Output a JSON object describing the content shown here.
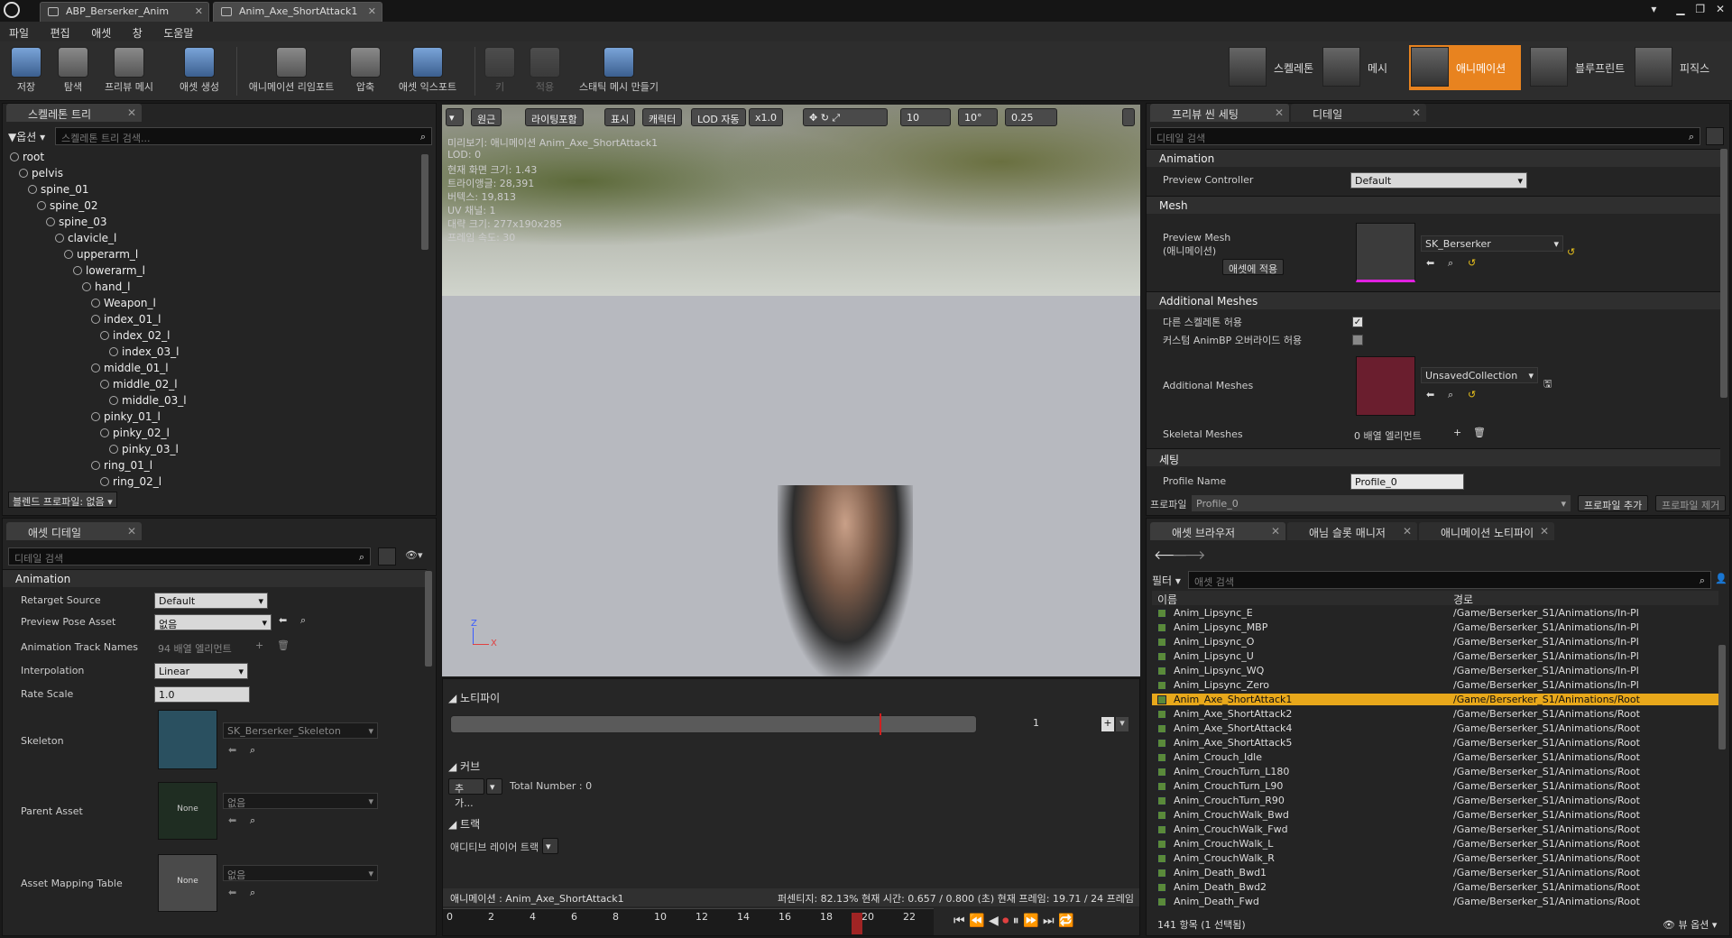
{
  "tabs": [
    {
      "label": "ABP_Berserker_Anim"
    },
    {
      "label": "Anim_Axe_ShortAttack1"
    }
  ],
  "menu": [
    "파일",
    "편집",
    "애셋",
    "창",
    "도움말"
  ],
  "toolbar": {
    "save": "저장",
    "browse": "탐색",
    "preview_mesh": "프리뷰 메시",
    "create_asset": "애셋 생성",
    "reimport": "애니메이션 리임포트",
    "compress": "압축",
    "export_asset": "애셋 익스포트",
    "key": "키",
    "apply": "적용",
    "make_static_mesh": "스태틱 메시 만들기"
  },
  "modes": {
    "skeleton": "스켈레톤",
    "mesh": "메시",
    "animation": "애니메이션",
    "blueprint": "블루프린트",
    "physics": "피직스"
  },
  "skeleton_tree": {
    "tab": "스켈레톤 트리",
    "options": "옵션",
    "search_placeholder": "스켈레톤 트리 검색...",
    "bones": [
      "root",
      "pelvis",
      "spine_01",
      "spine_02",
      "spine_03",
      "clavicle_l",
      "upperarm_l",
      "lowerarm_l",
      "hand_l",
      "Weapon_l",
      "index_01_l",
      "index_02_l",
      "index_03_l",
      "middle_01_l",
      "middle_02_l",
      "middle_03_l",
      "pinky_01_l",
      "pinky_02_l",
      "pinky_03_l",
      "ring_01_l",
      "ring_02_l"
    ],
    "blend_profile": "블렌드 프로파일: 없음"
  },
  "asset_details": {
    "tab": "애셋 디테일",
    "search_placeholder": "디테일 검색",
    "section": "Animation",
    "retarget_source_label": "Retarget Source",
    "retarget_source_value": "Default",
    "preview_pose_label": "Preview Pose Asset",
    "preview_pose_value": "없음",
    "track_names_label": "Animation Track Names",
    "track_names_value": "94 배열 엘리먼트",
    "interpolation_label": "Interpolation",
    "interpolation_value": "Linear",
    "rate_scale_label": "Rate Scale",
    "rate_scale_value": "1.0",
    "skeleton_label": "Skeleton",
    "skeleton_value": "SK_Berserker_Skeleton",
    "parent_asset_label": "Parent Asset",
    "parent_asset_value": "없음",
    "parent_asset_thumb": "None",
    "mapping_table_label": "Asset Mapping Table",
    "mapping_table_value": "없음",
    "mapping_table_thumb": "None"
  },
  "viewport": {
    "perspective": "원근",
    "lit": "라이팅포함",
    "show": "표시",
    "character": "캐릭터",
    "lod": "LOD 자동",
    "speed": "x1.0",
    "grid_snap": "10",
    "rot_snap": "10°",
    "scale_snap": "0.25",
    "info": [
      "미리보기: 애니메이션 Anim_Axe_ShortAttack1",
      "LOD: 0",
      "현재 화면 크기: 1.43",
      "트라이앵글: 28,391",
      "버텍스: 19,813",
      "UV 채널: 1",
      "대략 크기: 277x190x285",
      "프레임 속도: 30"
    ],
    "axis_z": "Z",
    "axis_x": "X"
  },
  "notify": {
    "section": "노티파이",
    "track_num": "1",
    "curves_section": "커브",
    "add": "추가...",
    "total": "Total Number : 0",
    "tracks_section": "트랙",
    "additive_track": "애디티브 레이어 트랙"
  },
  "timeline": {
    "status_left": "애니메이션 :  Anim_Axe_ShortAttack1",
    "status_right": "퍼센티지: 82.13% 현재 시간: 0.657 / 0.800 (초) 현재 프레임: 19.71 / 24 프레임",
    "ticks": [
      "0",
      "2",
      "4",
      "6",
      "8",
      "10",
      "12",
      "14",
      "16",
      "18",
      "20",
      "22"
    ],
    "progress": 0.8213
  },
  "preview_settings": {
    "tab": "프리뷰 씬 세팅",
    "tab2": "디테일",
    "search_placeholder": "디테일 검색",
    "animation_section": "Animation",
    "preview_controller_label": "Preview Controller",
    "preview_controller_value": "Default",
    "mesh_section": "Mesh",
    "preview_mesh_label": "Preview Mesh",
    "preview_mesh_sub": "(애니메이션)",
    "apply_to_asset": "애셋에 적용",
    "preview_mesh_value": "SK_Berserker",
    "additional_meshes_section": "Additional Meshes",
    "allow_diff_skel": "다른 스켈레톤 허용",
    "custom_animbp": "커스텀 AnimBP 오버라이드 허용",
    "additional_meshes_label": "Additional Meshes",
    "additional_meshes_value": "UnsavedCollection",
    "skeletal_meshes_label": "Skeletal Meshes",
    "skeletal_meshes_value": "0 배열 엘리먼트",
    "settings_section": "세팅",
    "profile_name_label": "Profile Name",
    "profile_name_value": "Profile_0",
    "profile_label": "프로파일",
    "profile_value": "Profile_0",
    "add_profile": "프로파일 추가",
    "remove_profile": "프로파일 제거"
  },
  "asset_browser": {
    "tab": "애셋 브라우저",
    "tab2": "애님 슬롯 매니저",
    "tab3": "애니메이션 노티파이",
    "filter": "필터",
    "search_placeholder": "애셋 검색",
    "col_name": "이름",
    "col_path": "경로",
    "rows": [
      {
        "name": "Anim_Lipsync_E",
        "path": "/Game/Berserker_S1/Animations/In-Pl"
      },
      {
        "name": "Anim_Lipsync_MBP",
        "path": "/Game/Berserker_S1/Animations/In-Pl"
      },
      {
        "name": "Anim_Lipsync_O",
        "path": "/Game/Berserker_S1/Animations/In-Pl"
      },
      {
        "name": "Anim_Lipsync_U",
        "path": "/Game/Berserker_S1/Animations/In-Pl"
      },
      {
        "name": "Anim_Lipsync_WQ",
        "path": "/Game/Berserker_S1/Animations/In-Pl"
      },
      {
        "name": "Anim_Lipsync_Zero",
        "path": "/Game/Berserker_S1/Animations/In-Pl"
      },
      {
        "name": "Anim_Axe_ShortAttack1",
        "path": "/Game/Berserker_S1/Animations/Root"
      },
      {
        "name": "Anim_Axe_ShortAttack2",
        "path": "/Game/Berserker_S1/Animations/Root"
      },
      {
        "name": "Anim_Axe_ShortAttack4",
        "path": "/Game/Berserker_S1/Animations/Root"
      },
      {
        "name": "Anim_Axe_ShortAttack5",
        "path": "/Game/Berserker_S1/Animations/Root"
      },
      {
        "name": "Anim_Crouch_Idle",
        "path": "/Game/Berserker_S1/Animations/Root"
      },
      {
        "name": "Anim_CrouchTurn_L180",
        "path": "/Game/Berserker_S1/Animations/Root"
      },
      {
        "name": "Anim_CrouchTurn_L90",
        "path": "/Game/Berserker_S1/Animations/Root"
      },
      {
        "name": "Anim_CrouchTurn_R90",
        "path": "/Game/Berserker_S1/Animations/Root"
      },
      {
        "name": "Anim_CrouchWalk_Bwd",
        "path": "/Game/Berserker_S1/Animations/Root"
      },
      {
        "name": "Anim_CrouchWalk_Fwd",
        "path": "/Game/Berserker_S1/Animations/Root"
      },
      {
        "name": "Anim_CrouchWalk_L",
        "path": "/Game/Berserker_S1/Animations/Root"
      },
      {
        "name": "Anim_CrouchWalk_R",
        "path": "/Game/Berserker_S1/Animations/Root"
      },
      {
        "name": "Anim_Death_Bwd1",
        "path": "/Game/Berserker_S1/Animations/Root"
      },
      {
        "name": "Anim_Death_Bwd2",
        "path": "/Game/Berserker_S1/Animations/Root"
      },
      {
        "name": "Anim_Death_Fwd",
        "path": "/Game/Berserker_S1/Animations/Root"
      }
    ],
    "selected_index": 6,
    "count": "141 항목 (1 선택됨)",
    "view_options": "뷰 옵션"
  },
  "colors": {
    "accent": "#e8831f",
    "selection": "#e8a81b"
  }
}
